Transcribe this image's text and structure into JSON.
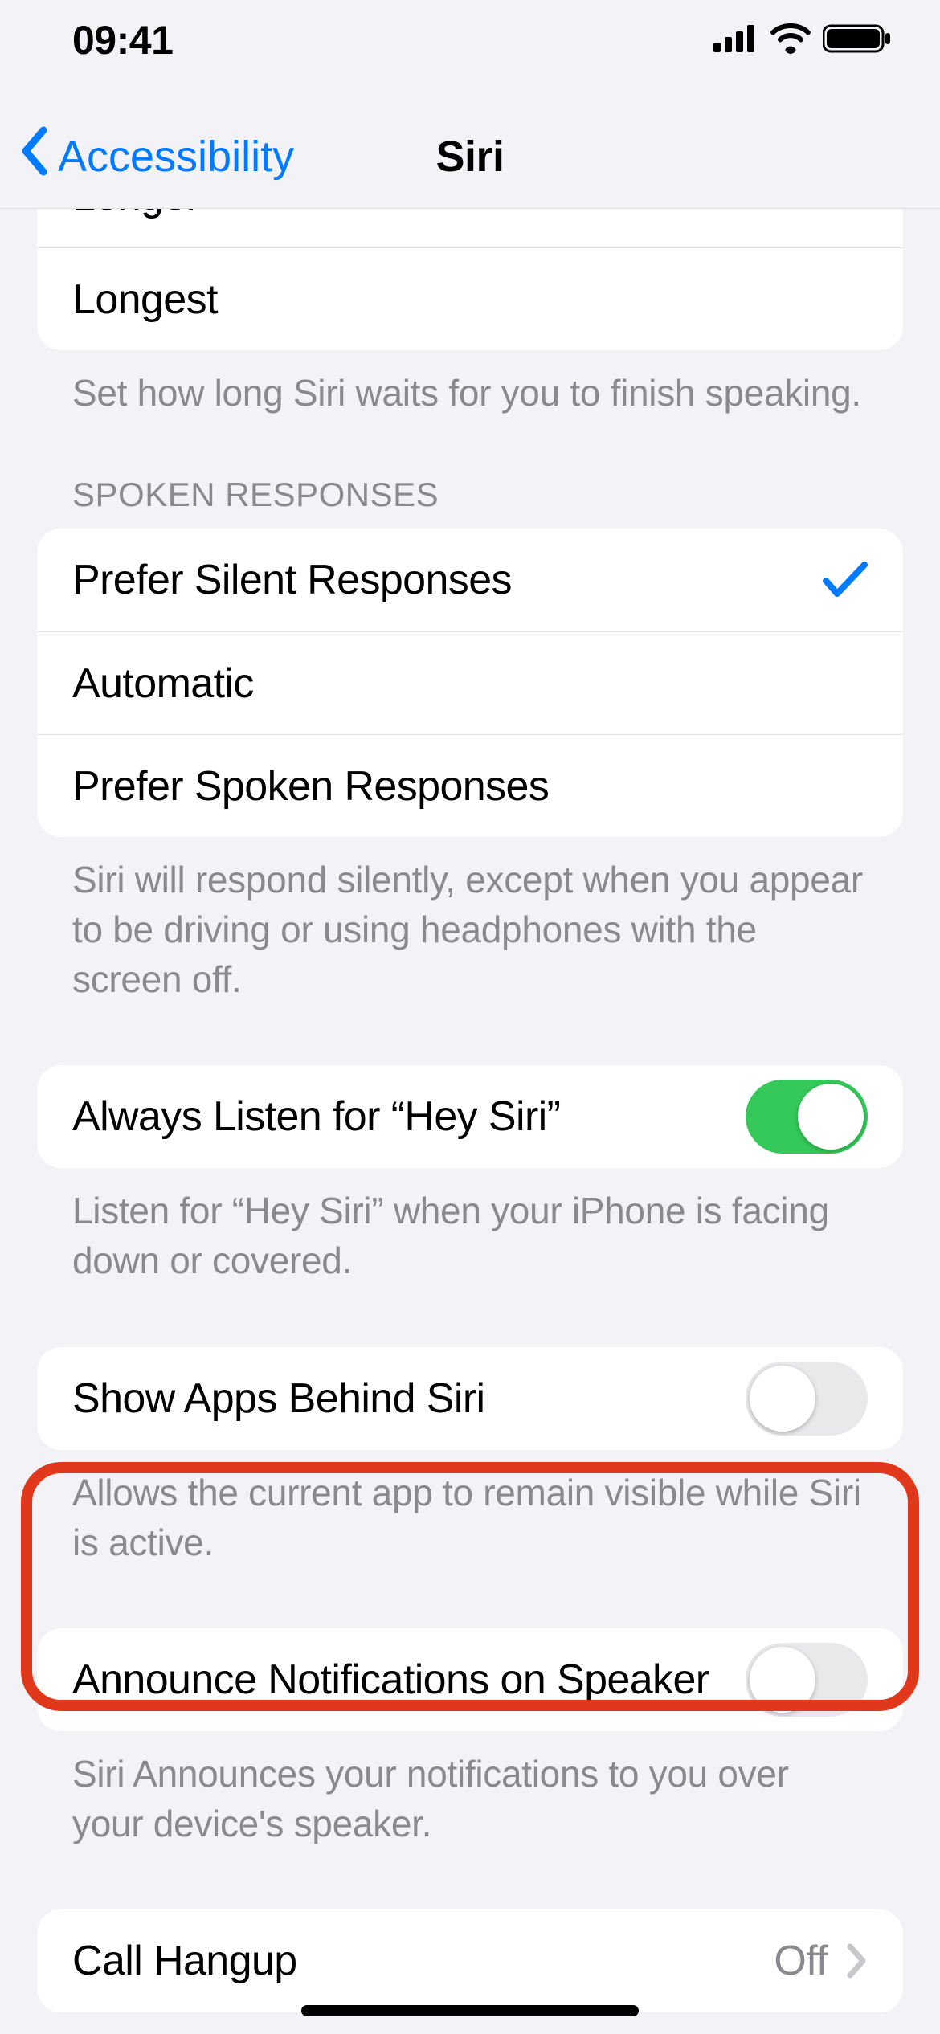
{
  "status": {
    "time": "09:41"
  },
  "nav": {
    "back": "Accessibility",
    "title": "Siri"
  },
  "pause_group": {
    "options": [
      "Longer",
      "Longest"
    ],
    "footer": "Set how long Siri waits for you to finish speaking."
  },
  "spoken": {
    "header": "SPOKEN RESPONSES",
    "options": [
      {
        "label": "Prefer Silent Responses",
        "selected": true
      },
      {
        "label": "Automatic",
        "selected": false
      },
      {
        "label": "Prefer Spoken Responses",
        "selected": false
      }
    ],
    "footer": "Siri will respond silently, except when you appear to be driving or using headphones with the screen off."
  },
  "hey_siri": {
    "label": "Always Listen for “Hey Siri”",
    "on": true,
    "footer": "Listen for “Hey Siri” when your iPhone is facing down or covered."
  },
  "show_apps": {
    "label": "Show Apps Behind Siri",
    "on": false,
    "footer": "Allows the current app to remain visible while Siri is active."
  },
  "announce": {
    "label": "Announce Notifications on Speaker",
    "on": false,
    "footer": "Siri Announces your notifications to you over your device's speaker."
  },
  "call_hangup": {
    "label": "Call Hangup",
    "value": "Off"
  }
}
